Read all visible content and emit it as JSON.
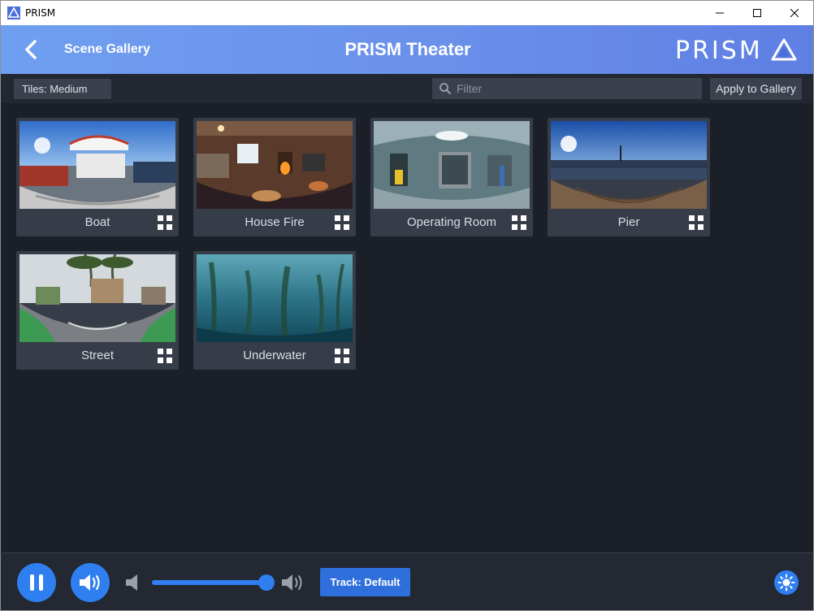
{
  "window": {
    "title": "PRISM",
    "controls": [
      "minimize",
      "maximize",
      "close"
    ]
  },
  "header": {
    "back_label": "Scene Gallery",
    "title": "PRISM Theater",
    "brand": "PRISM",
    "gradient_colors": [
      "#6f9ff0",
      "#5f7fe3"
    ]
  },
  "toolbar": {
    "tile_size": "Tiles: Medium",
    "filter_placeholder": "Filter",
    "filter_value": "",
    "apply_label": "Apply to Gallery"
  },
  "gallery": {
    "tiles": [
      {
        "label": "Boat",
        "icon": "grid-icon"
      },
      {
        "label": "House Fire",
        "icon": "grid-icon"
      },
      {
        "label": "Operating Room",
        "icon": "grid-icon"
      },
      {
        "label": "Pier",
        "icon": "grid-icon"
      },
      {
        "label": "Street",
        "icon": "grid-icon"
      },
      {
        "label": "Underwater",
        "icon": "grid-icon"
      }
    ]
  },
  "player": {
    "state": "playing",
    "volume": 0.94,
    "track_label": "Track: Default",
    "accent_color": "#2f7ff0"
  }
}
